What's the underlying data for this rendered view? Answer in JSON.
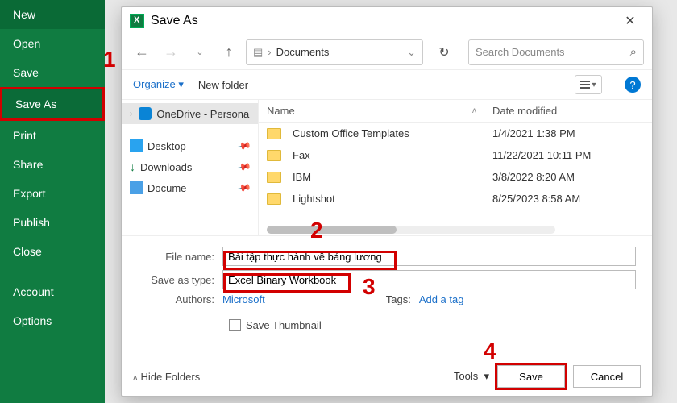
{
  "backstage": {
    "items": [
      "New",
      "Open",
      "Save",
      "Save As",
      "Print",
      "Share",
      "Export",
      "Publish",
      "Close"
    ],
    "bottom": [
      "Account",
      "Options"
    ],
    "selected": "Save As"
  },
  "dialog": {
    "title": "Save As",
    "nav": {
      "path_prefix": "›",
      "path_label": "Documents",
      "path_chevron": "⌄",
      "refresh": "↻",
      "search_placeholder": "Search Documents",
      "search_icon": "⌕"
    },
    "toolbar": {
      "organize": "Organize ▾",
      "new_folder": "New folder",
      "view_caret": "▾",
      "help": "?"
    },
    "tree": [
      {
        "icon": "cloud",
        "label": "OneDrive - Persona",
        "expandable": true,
        "sel": true
      },
      {
        "icon": "desktop",
        "label": "Desktop",
        "pin": true
      },
      {
        "icon": "dl",
        "label": "Downloads",
        "pin": true
      },
      {
        "icon": "doc",
        "label": "Documents",
        "pin": true,
        "cut": true
      }
    ],
    "list": {
      "col_name": "Name",
      "col_date": "Date modified",
      "rows": [
        {
          "name": "Custom Office Templates",
          "date": "1/4/2021 1:38 PM"
        },
        {
          "name": "Fax",
          "date": "11/22/2021 10:11 PM"
        },
        {
          "name": "IBM",
          "date": "3/8/2022 8:20 AM"
        },
        {
          "name": "Lightshot",
          "date": "8/25/2023 8:58 AM"
        }
      ]
    },
    "form": {
      "file_label": "File name:",
      "file_value": "Bài tập thực hành về bảng lương",
      "type_label": "Save as type:",
      "type_value": "Excel Binary Workbook",
      "authors_label": "Authors:",
      "authors_value": "Microsoft",
      "tags_label": "Tags:",
      "tags_value": "Add a tag",
      "thumb_label": "Save Thumbnail"
    },
    "footer": {
      "hide": "Hide Folders",
      "tools": "Tools",
      "save": "Save",
      "cancel": "Cancel"
    }
  },
  "callouts": {
    "c1": "1",
    "c2": "2",
    "c3": "3",
    "c4": "4"
  }
}
